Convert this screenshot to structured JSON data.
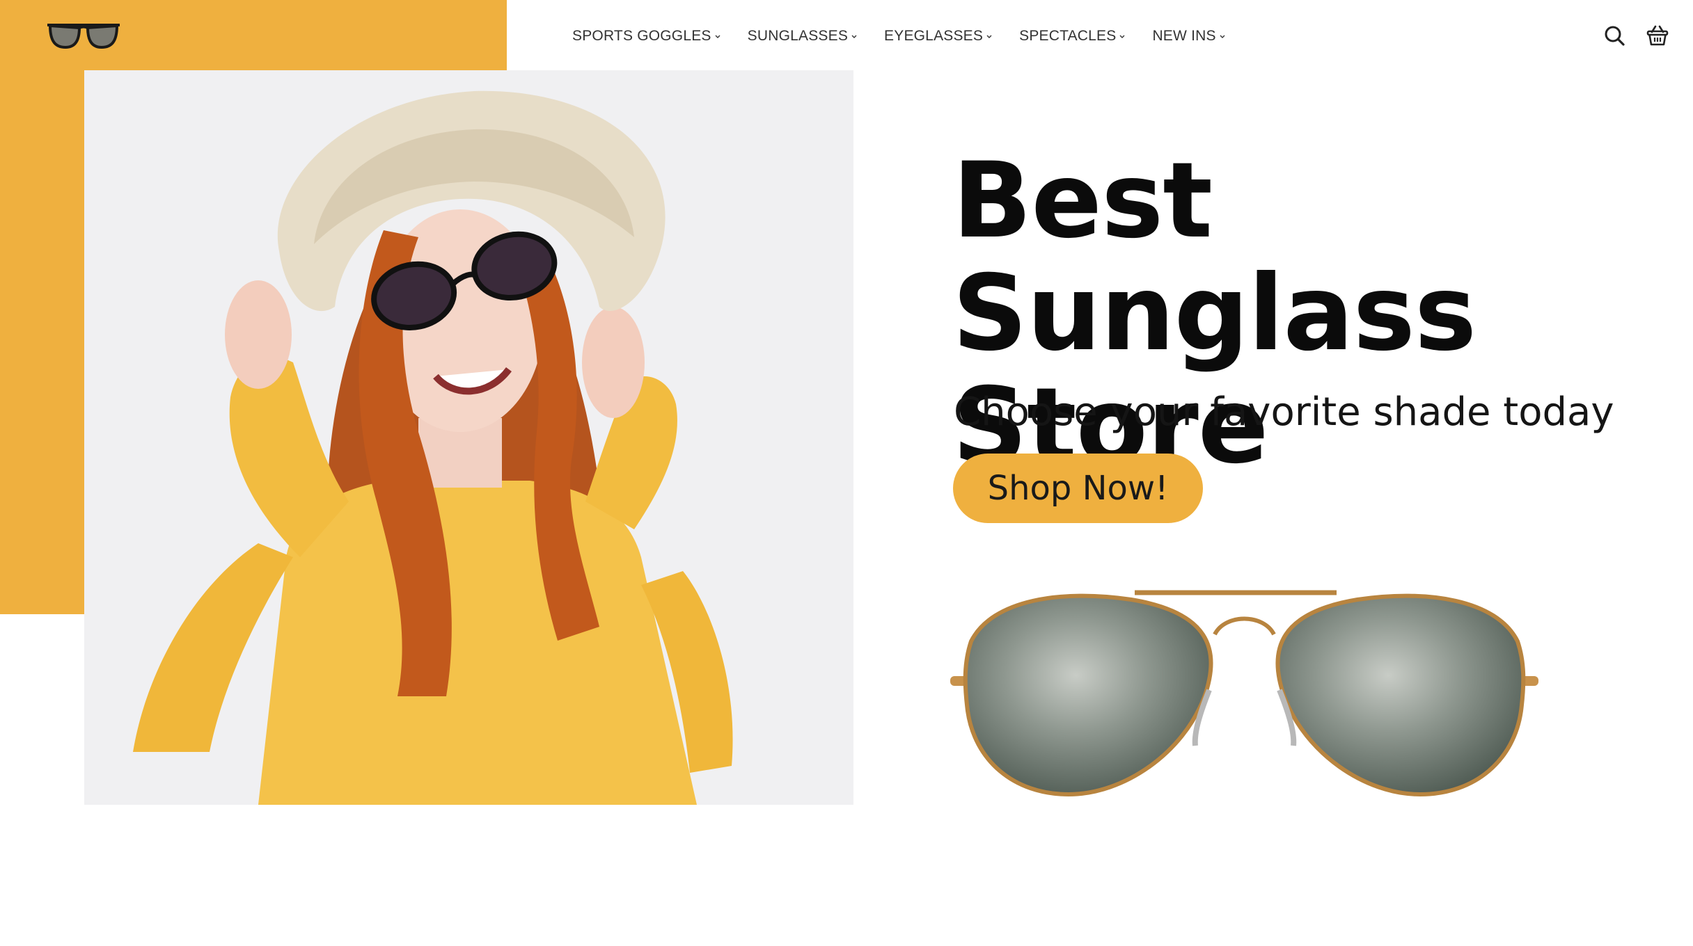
{
  "brand": {
    "logo_icon": "sunglasses-logo-icon",
    "accent_color": "#EFB03F"
  },
  "nav": {
    "items": [
      {
        "label": "SPORTS GOGGLES"
      },
      {
        "label": "SUNGLASSES"
      },
      {
        "label": "EYEGLASSES"
      },
      {
        "label": "SPECTACLES"
      },
      {
        "label": "NEW INS"
      }
    ],
    "chevron_icon": "chevron-down-icon"
  },
  "header_icons": {
    "search": "search-icon",
    "cart": "basket-icon"
  },
  "hero": {
    "title_line1": "Best Sunglass",
    "title_line2": "Store",
    "subtitle": "Choose your favorite shade today",
    "cta_label": "Shop Now!"
  },
  "images": {
    "model_photo": "woman-in-hat-and-sunglasses-photo",
    "product_photo": "aviator-sunglasses-photo"
  }
}
